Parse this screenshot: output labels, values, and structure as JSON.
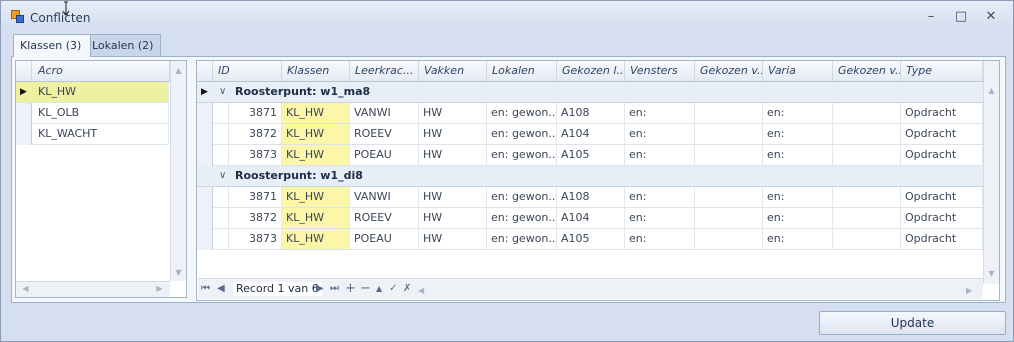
{
  "window": {
    "title": "Conflicten"
  },
  "tabs": [
    {
      "label": "Klassen (3)",
      "active": true
    },
    {
      "label": "Lokalen (2)",
      "active": false
    }
  ],
  "left_grid": {
    "header": "Acro",
    "rows": [
      {
        "acro": "KL_HW",
        "selected": true
      },
      {
        "acro": "KL_OLB"
      },
      {
        "acro": "KL_WACHT"
      }
    ]
  },
  "right_grid": {
    "columns": [
      "ID",
      "Klassen",
      "Leerkrac...",
      "Vakken",
      "Lokalen",
      "Gekozen l...",
      "Vensters",
      "Gekozen v...",
      "Varia",
      "Gekozen v...",
      "Type"
    ],
    "groups": [
      {
        "title": "Roosterpunt: w1_ma8",
        "rows": [
          [
            "3871",
            "KL_HW",
            "VANWI",
            "HW",
            "en: gewon...",
            "A108",
            "en:",
            "",
            "en:",
            "",
            "Opdracht"
          ],
          [
            "3872",
            "KL_HW",
            "ROEEV",
            "HW",
            "en: gewon...",
            "A104",
            "en:",
            "",
            "en:",
            "",
            "Opdracht"
          ],
          [
            "3873",
            "KL_HW",
            "POEAU",
            "HW",
            "en: gewon...",
            "A105",
            "en:",
            "",
            "en:",
            "",
            "Opdracht"
          ]
        ]
      },
      {
        "title": "Roosterpunt: w1_di8",
        "rows": [
          [
            "3871",
            "KL_HW",
            "VANWI",
            "HW",
            "en: gewon...",
            "A108",
            "en:",
            "",
            "en:",
            "",
            "Opdracht"
          ],
          [
            "3872",
            "KL_HW",
            "ROEEV",
            "HW",
            "en: gewon...",
            "A104",
            "en:",
            "",
            "en:",
            "",
            "Opdracht"
          ],
          [
            "3873",
            "KL_HW",
            "POEAU",
            "HW",
            "en: gewon...",
            "A105",
            "en:",
            "",
            "en:",
            "",
            "Opdracht"
          ]
        ]
      }
    ]
  },
  "navigator": {
    "record_text": "Record 1 van 6"
  },
  "buttons": {
    "update": "Update"
  },
  "colors": {
    "highlight": "#fbf6a8",
    "selected_row": "#eef1a0",
    "accent": "#9db0cc"
  }
}
